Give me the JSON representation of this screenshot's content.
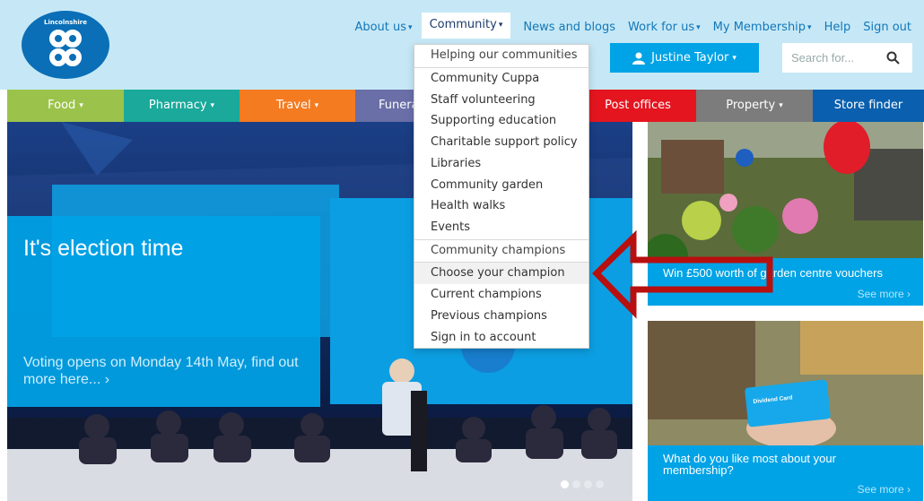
{
  "header": {
    "logo_text": "Lincolnshire",
    "topnav": [
      {
        "label": "About us",
        "caret": true
      },
      {
        "label": "Community",
        "caret": true
      },
      {
        "label": "News and blogs",
        "caret": false
      },
      {
        "label": "Work for us",
        "caret": true
      },
      {
        "label": "My Membership",
        "caret": true
      },
      {
        "label": "Help",
        "caret": false
      },
      {
        "label": "Sign out",
        "caret": false
      }
    ],
    "user_label": "Justine Taylor",
    "search_placeholder": "Search for..."
  },
  "categories": [
    {
      "label": "Food",
      "caret": true,
      "color": "#9bc34b"
    },
    {
      "label": "Pharmacy",
      "caret": true,
      "color": "#1aa99a"
    },
    {
      "label": "Travel",
      "caret": true,
      "color": "#f47b20"
    },
    {
      "label": "Funeral",
      "caret": false,
      "color": "#6a6fa8"
    },
    {
      "label": "Post offices",
      "caret": false,
      "color": "#e4151f"
    },
    {
      "label": "Property",
      "caret": true,
      "color": "#7c7c7c"
    },
    {
      "label": "Store finder",
      "caret": false,
      "color": "#0a5fae"
    }
  ],
  "hero": {
    "heading": "It's election time",
    "text": "Voting opens on Monday 14th May, find out more here...  ›"
  },
  "cards": [
    {
      "title": "Win £500 worth of garden centre vouchers",
      "more": "See more ›"
    },
    {
      "title": "What do you like most about your membership?",
      "more": "See more ›",
      "image_text": "Dividend Card"
    }
  ],
  "dropdown": {
    "items": [
      "Helping our communities",
      "Community Cuppa",
      "Staff volunteering",
      "Supporting education",
      "Charitable support policy",
      "Libraries",
      "Community garden",
      "Health walks",
      "Events",
      "Community champions",
      "Choose your champion",
      "Current champions",
      "Previous champions",
      "Sign in to account"
    ],
    "highlighted_index": 10
  },
  "colors": {
    "brand_blue": "#00a3e6",
    "header_bg": "#c6e8f6",
    "annotation_red": "#b80f0f"
  }
}
